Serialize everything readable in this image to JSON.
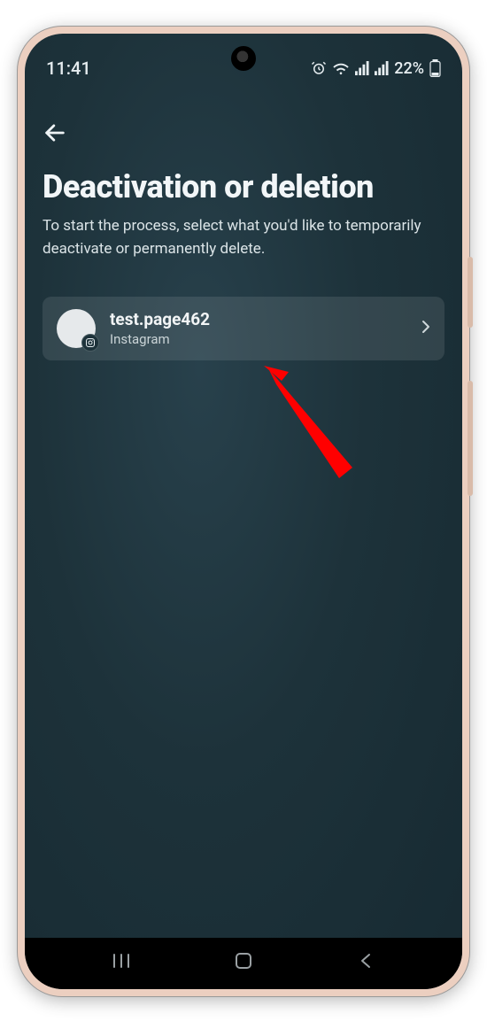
{
  "status": {
    "time": "11:41",
    "battery_pct": "22%"
  },
  "page": {
    "title": "Deactivation or deletion",
    "subtitle": "To start the process, select what you'd like to temporarily deactivate or permanently delete."
  },
  "account": {
    "name": "test.page462",
    "service": "Instagram"
  }
}
